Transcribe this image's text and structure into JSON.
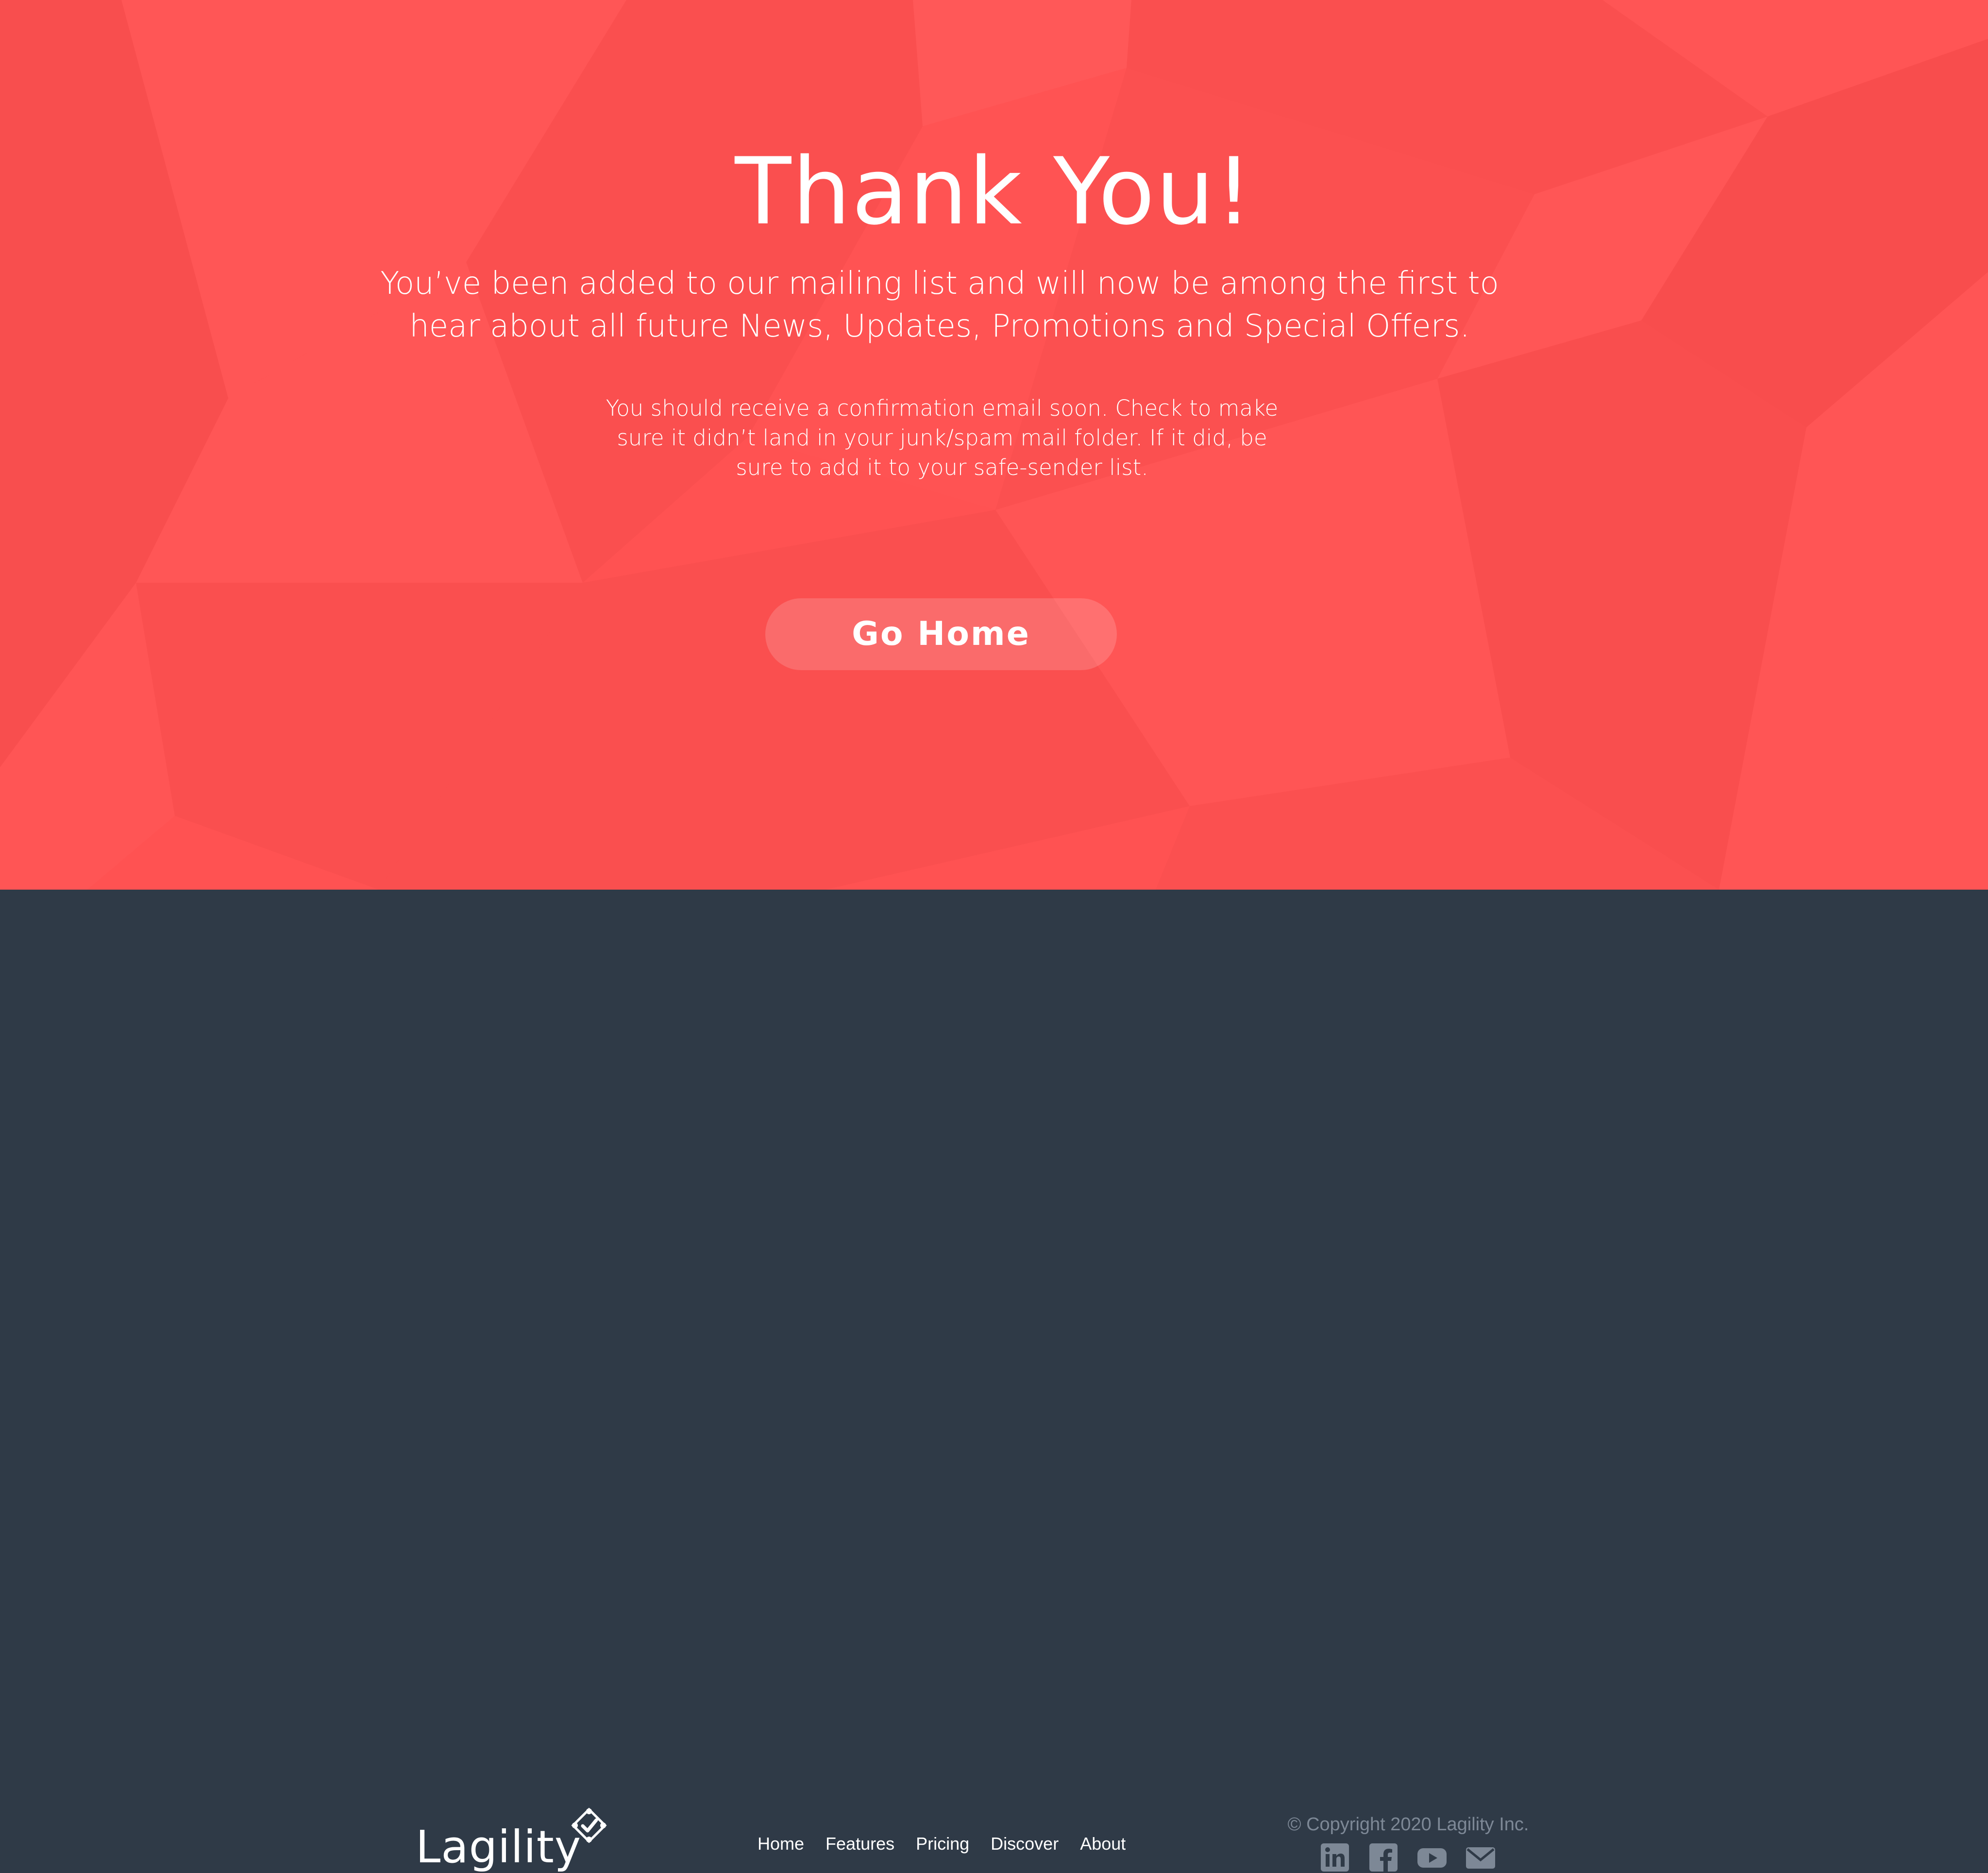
{
  "hero": {
    "title": "Thank You!",
    "subtitle": "You’ve been added to our mailing list and will now be among the first to hear about all future News, Updates, Promotions and Special Offers.",
    "note": "You should receive a confirmation email soon. Check to make sure it didn’t land in your junk/spam mail folder. If it did, be sure to add it to your safe-sender list.",
    "button_label": "Go Home"
  },
  "footer": {
    "logo_text": "Lagility",
    "nav": [
      "Home",
      "Features",
      "Pricing",
      "Discover",
      "About"
    ],
    "copyright": "© Copyright 2020 Lagility Inc.",
    "social_icons": [
      "linkedin-icon",
      "facebook-icon",
      "youtube-icon",
      "email-icon"
    ]
  },
  "colors": {
    "hero_background": "#ff5252",
    "footer_background": "#2f3a47",
    "footer_muted_text": "#7d8896",
    "text": "#ffffff"
  }
}
